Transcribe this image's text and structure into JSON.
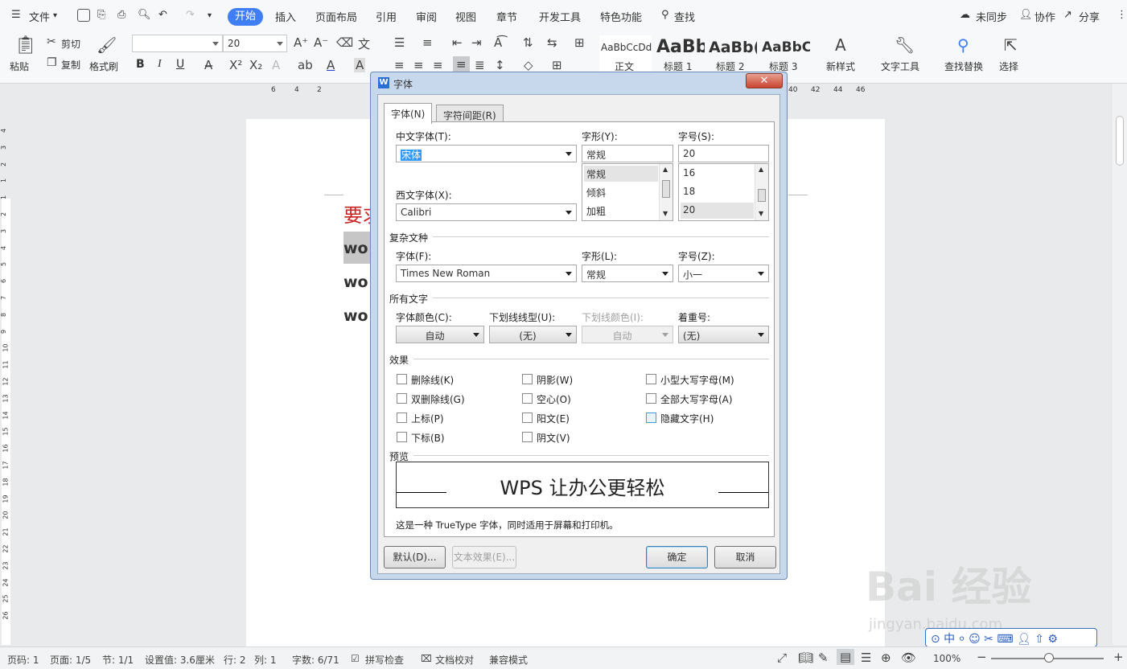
{
  "menubar": {
    "file": "文件",
    "tabs": [
      "开始",
      "插入",
      "页面布局",
      "引用",
      "审阅",
      "视图",
      "章节",
      "开发工具",
      "特色功能"
    ],
    "search": "查找",
    "sync": "未同步",
    "collab": "协作",
    "share": "分享"
  },
  "ribbon": {
    "paste": "粘贴",
    "cut": "剪切",
    "copy": "复制",
    "format_painter": "格式刷",
    "font_name": "",
    "font_size": "20",
    "bold": "B",
    "italic": "I",
    "underline": "U",
    "styles": [
      {
        "preview": "AaBbCcDd",
        "name": "正文"
      },
      {
        "preview": "AaBb",
        "name": "标题 1"
      },
      {
        "preview": "AaBb(",
        "name": "标题 2"
      },
      {
        "preview": "AaBbC",
        "name": "标题 3"
      }
    ],
    "new_style": "新样式",
    "text_tools": "文字工具",
    "find_replace": "查找替换",
    "select": "选择"
  },
  "ruler": {
    "h_left": [
      "6",
      "4",
      "2"
    ],
    "h_right": [
      "40",
      "42",
      "44",
      "46"
    ],
    "v": [
      "4",
      "3",
      "2",
      "1",
      "1",
      "2",
      "3",
      "4",
      "5",
      "6",
      "7",
      "8",
      "9",
      "10",
      "11",
      "12",
      "13",
      "14",
      "15",
      "16",
      "17",
      "18",
      "19",
      "20",
      "21",
      "22",
      "23",
      "24",
      "25",
      "26"
    ]
  },
  "document": {
    "lines": [
      "要求",
      "wo",
      "wo",
      "wo"
    ],
    "first_line_color": "#cc2222"
  },
  "dialog": {
    "title": "字体",
    "tabs": [
      "字体(N)",
      "字符间距(R)"
    ],
    "cn_font_label": "中文字体(T):",
    "cn_font_value": "宋体",
    "style_label": "字形(Y):",
    "style_value": "常规",
    "style_list": [
      "常规",
      "倾斜",
      "加粗"
    ],
    "size_label": "字号(S):",
    "size_value": "20",
    "size_list": [
      "16",
      "18",
      "20"
    ],
    "west_font_label": "西文字体(X):",
    "west_font_value": "Calibri",
    "complex_section": "复杂文种",
    "complex_font_label": "字体(F):",
    "complex_font_value": "Times New Roman",
    "complex_style_label": "字形(L):",
    "complex_style_value": "常规",
    "complex_size_label": "字号(Z):",
    "complex_size_value": "小一",
    "all_text_section": "所有文字",
    "font_color_label": "字体颜色(C):",
    "font_color_value": "自动",
    "underline_type_label": "下划线线型(U):",
    "underline_type_value": "(无)",
    "underline_color_label": "下划线颜色(I):",
    "underline_color_value": "自动",
    "emphasis_label": "着重号:",
    "emphasis_value": "(无)",
    "effects_section": "效果",
    "effects": [
      [
        "删除线(K)",
        "阴影(W)",
        "小型大写字母(M)"
      ],
      [
        "双删除线(G)",
        "空心(O)",
        "全部大写字母(A)"
      ],
      [
        "上标(P)",
        "阳文(E)",
        "隐藏文字(H)"
      ],
      [
        "下标(B)",
        "阴文(V)",
        ""
      ]
    ],
    "preview_section": "预览",
    "preview_text": "WPS 让办公更轻松",
    "preview_note": "这是一种 TrueType 字体，同时适用于屏幕和打印机。",
    "default_btn": "默认(D)...",
    "text_effect_btn": "文本效果(E)...",
    "ok_btn": "确定",
    "cancel_btn": "取消"
  },
  "statusbar": {
    "page_num": "页码: 1",
    "pages": "页面: 1/5",
    "section": "节: 1/1",
    "setting": "设置值: 3.6厘米",
    "row": "行: 2",
    "col": "列: 1",
    "words": "字数: 6/71",
    "spell": "拼写检查",
    "proof": "文档校对",
    "compat": "兼容模式",
    "zoom": "100%"
  },
  "watermark": {
    "text": "Bai 经验",
    "sub": "jingyan.baidu.com"
  }
}
